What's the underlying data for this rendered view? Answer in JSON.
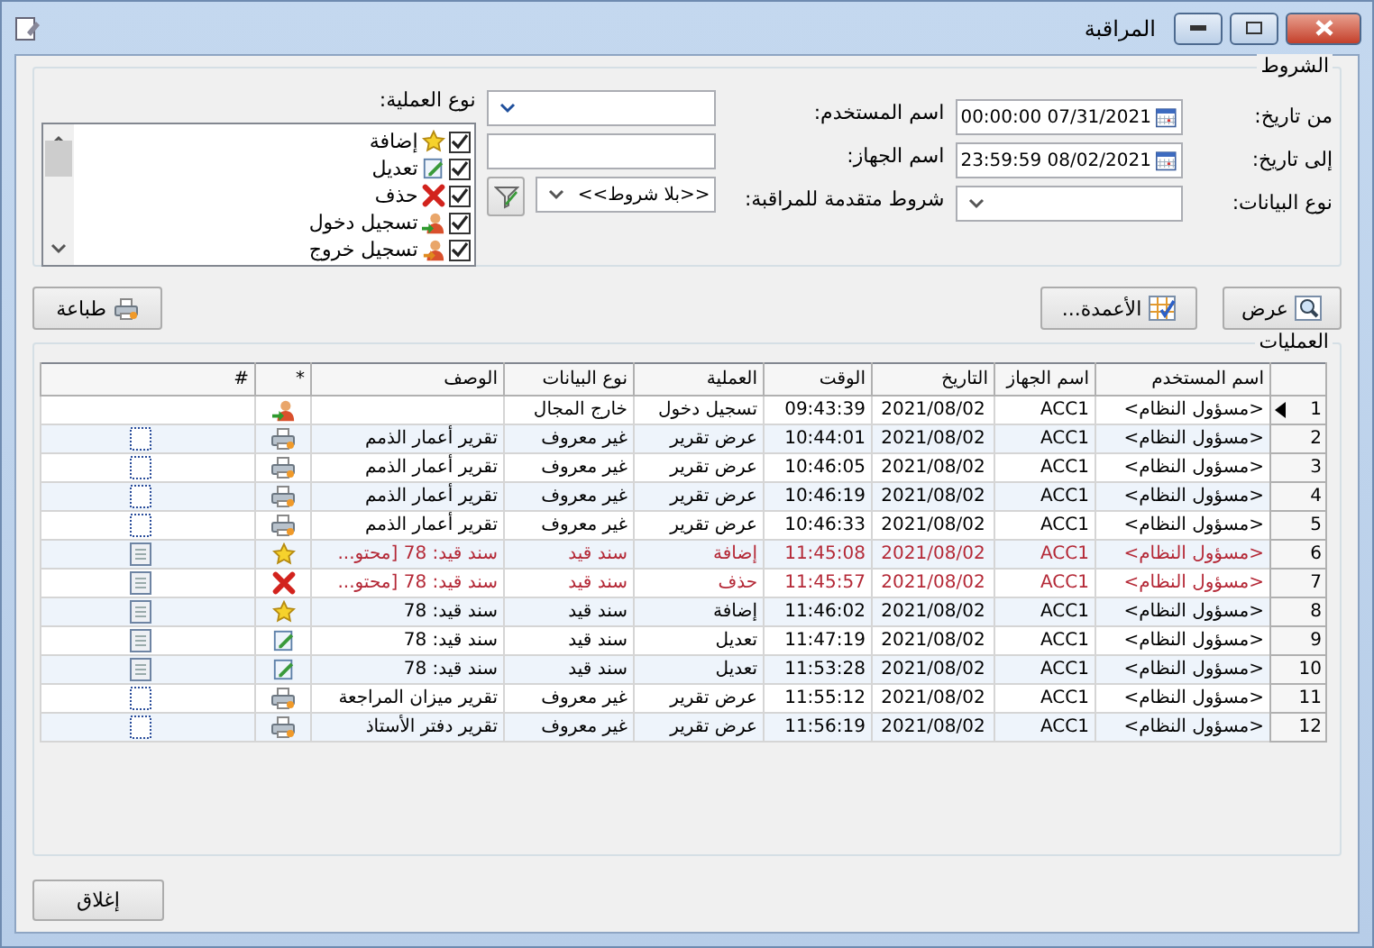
{
  "window": {
    "title": "المراقبة"
  },
  "conditions": {
    "title": "الشروط",
    "from_date": {
      "label": "من تاريخ:",
      "value": "00:00:00 07/31/2021"
    },
    "to_date": {
      "label": "إلى تاريخ:",
      "value": "23:59:59 08/02/2021"
    },
    "data_type": {
      "label": "نوع البيانات:"
    },
    "user_name": {
      "label": "اسم المستخدم:"
    },
    "device_name": {
      "label": "اسم الجهاز:"
    },
    "advanced": {
      "label": "شروط متقدمة للمراقبة:",
      "value": "<<بلا شروط>>"
    },
    "operation_type": {
      "label": "نوع العملية:",
      "items": [
        {
          "label": "إضافة",
          "kind": "add",
          "checked": true
        },
        {
          "label": "تعديل",
          "kind": "edit",
          "checked": true
        },
        {
          "label": "حذف",
          "kind": "delete",
          "checked": true
        },
        {
          "label": "تسجيل دخول",
          "kind": "login",
          "checked": true
        },
        {
          "label": "تسجيل خروج",
          "kind": "logout",
          "checked": true
        }
      ]
    }
  },
  "toolbar": {
    "view": "عرض",
    "columns": "الأعمدة...",
    "print": "طباعة"
  },
  "operations": {
    "title": "العمليات",
    "columns": [
      "اسم المستخدم",
      "اسم الجهاز",
      "التاريخ",
      "الوقت",
      "العملية",
      "نوع البيانات",
      "الوصف",
      "*",
      "#"
    ],
    "rows": [
      {
        "n": "1",
        "selected": true,
        "highlight": false,
        "user": "<مسؤول النظام>",
        "device": "ACC1",
        "date": "2021/08/02",
        "time": "09:43:39",
        "operation": "تسجيل دخول",
        "data_type": "خارج المجال",
        "desc": "",
        "kind": "login"
      },
      {
        "n": "2",
        "selected": false,
        "highlight": false,
        "user": "<مسؤول النظام>",
        "device": "ACC1",
        "date": "2021/08/02",
        "time": "10:44:01",
        "operation": "عرض تقرير",
        "data_type": "غير معروف",
        "desc": "تقرير أعمار الذمم",
        "kind": "report"
      },
      {
        "n": "3",
        "selected": false,
        "highlight": false,
        "user": "<مسؤول النظام>",
        "device": "ACC1",
        "date": "2021/08/02",
        "time": "10:46:05",
        "operation": "عرض تقرير",
        "data_type": "غير معروف",
        "desc": "تقرير أعمار الذمم",
        "kind": "report"
      },
      {
        "n": "4",
        "selected": false,
        "highlight": false,
        "user": "<مسؤول النظام>",
        "device": "ACC1",
        "date": "2021/08/02",
        "time": "10:46:19",
        "operation": "عرض تقرير",
        "data_type": "غير معروف",
        "desc": "تقرير أعمار الذمم",
        "kind": "report"
      },
      {
        "n": "5",
        "selected": false,
        "highlight": false,
        "user": "<مسؤول النظام>",
        "device": "ACC1",
        "date": "2021/08/02",
        "time": "10:46:33",
        "operation": "عرض تقرير",
        "data_type": "غير معروف",
        "desc": "تقرير أعمار الذمم",
        "kind": "report"
      },
      {
        "n": "6",
        "selected": false,
        "highlight": true,
        "user": "<مسؤول النظام>",
        "device": "ACC1",
        "date": "2021/08/02",
        "time": "11:45:08",
        "operation": "إضافة",
        "data_type": "سند قيد",
        "desc": "سند قيد: 78 [محتو...",
        "kind": "add"
      },
      {
        "n": "7",
        "selected": false,
        "highlight": true,
        "user": "<مسؤول النظام>",
        "device": "ACC1",
        "date": "2021/08/02",
        "time": "11:45:57",
        "operation": "حذف",
        "data_type": "سند قيد",
        "desc": "سند قيد: 78 [محتو...",
        "kind": "delete"
      },
      {
        "n": "8",
        "selected": false,
        "highlight": false,
        "user": "<مسؤول النظام>",
        "device": "ACC1",
        "date": "2021/08/02",
        "time": "11:46:02",
        "operation": "إضافة",
        "data_type": "سند قيد",
        "desc": "سند قيد: 78",
        "kind": "add"
      },
      {
        "n": "9",
        "selected": false,
        "highlight": false,
        "user": "<مسؤول النظام>",
        "device": "ACC1",
        "date": "2021/08/02",
        "time": "11:47:19",
        "operation": "تعديل",
        "data_type": "سند قيد",
        "desc": "سند قيد: 78",
        "kind": "edit"
      },
      {
        "n": "10",
        "selected": false,
        "highlight": false,
        "user": "<مسؤول النظام>",
        "device": "ACC1",
        "date": "2021/08/02",
        "time": "11:53:28",
        "operation": "تعديل",
        "data_type": "سند قيد",
        "desc": "سند قيد: 78",
        "kind": "edit"
      },
      {
        "n": "11",
        "selected": false,
        "highlight": false,
        "user": "<مسؤول النظام>",
        "device": "ACC1",
        "date": "2021/08/02",
        "time": "11:55:12",
        "operation": "عرض تقرير",
        "data_type": "غير معروف",
        "desc": "تقرير ميزان المراجعة",
        "kind": "report"
      },
      {
        "n": "12",
        "selected": false,
        "highlight": false,
        "user": "<مسؤول النظام>",
        "device": "ACC1",
        "date": "2021/08/02",
        "time": "11:56:19",
        "operation": "عرض تقرير",
        "data_type": "غير معروف",
        "desc": "تقرير دفتر الأستاذ",
        "kind": "report"
      }
    ]
  },
  "close_button": "إغلاق"
}
